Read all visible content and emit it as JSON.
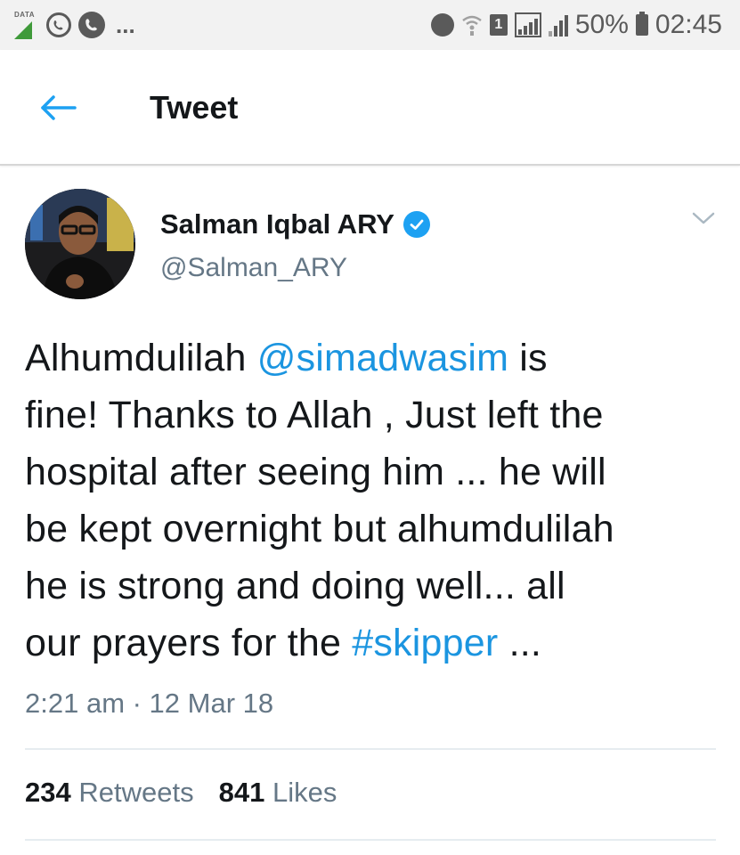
{
  "status_bar": {
    "data_label": "DATA",
    "dots": "...",
    "sim_slot": "1",
    "battery": "50%",
    "time": "02:45"
  },
  "header": {
    "title": "Tweet"
  },
  "tweet": {
    "author_name": "Salman Iqbal ARY",
    "handle": "@Salman_ARY",
    "lines": [
      [
        {
          "t": "Alhumdulilah "
        },
        {
          "t": "@simadwasim",
          "link": true
        },
        {
          "t": " is"
        }
      ],
      [
        {
          "t": "fine! Thanks to Allah , Just left the"
        }
      ],
      [
        {
          "t": "hospital after seeing him ... he will"
        }
      ],
      [
        {
          "t": "be kept overnight but alhumdulilah"
        }
      ],
      [
        {
          "t": "he is strong and doing well... all"
        }
      ],
      [
        {
          "t": "our prayers for the "
        },
        {
          "t": "#skipper",
          "link": true
        },
        {
          "t": " ..."
        }
      ]
    ],
    "timestamp": "2:21 am · 12 Mar 18",
    "retweets_count": "234",
    "retweets_label": "Retweets",
    "likes_count": "841",
    "likes_label": "Likes"
  },
  "colors": {
    "link": "#1b95e0",
    "verified": "#1da1f2",
    "secondary_text": "#657786"
  }
}
